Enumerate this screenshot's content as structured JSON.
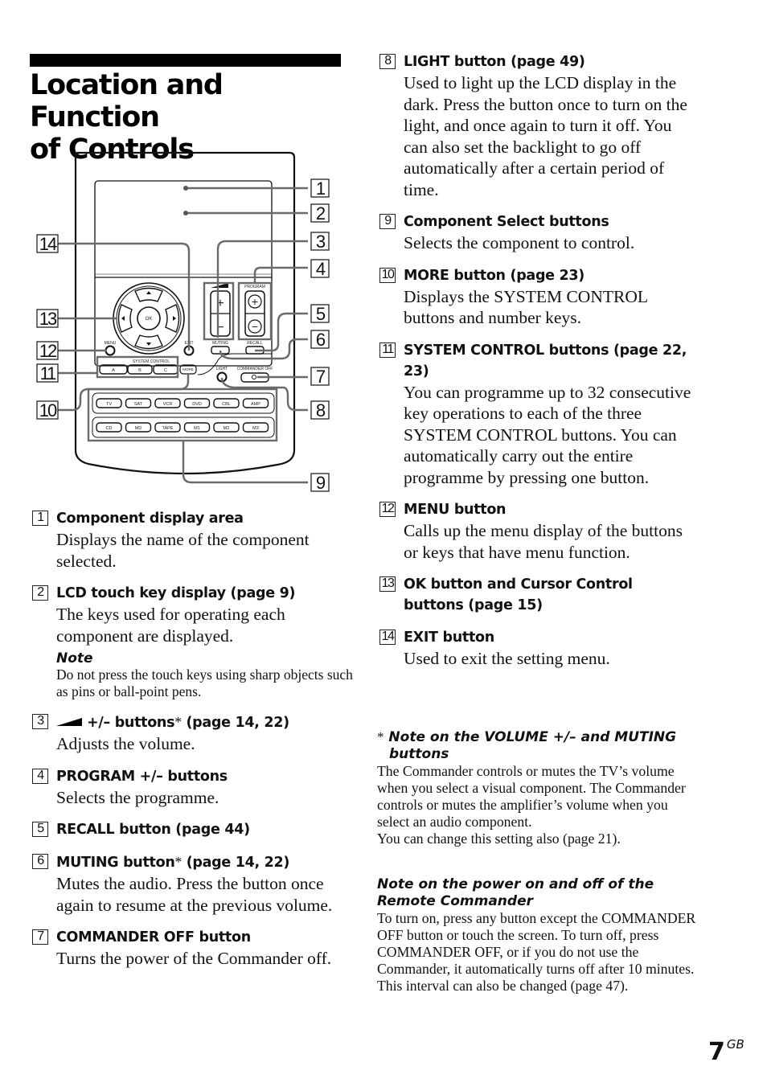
{
  "page": {
    "title": "Location and Function of Controls",
    "title_line1": "Location and Function",
    "title_line2": "of Controls",
    "page_number": "7",
    "page_suffix": "GB"
  },
  "diagram": {
    "callouts_right": [
      "1",
      "2",
      "3",
      "4",
      "5",
      "6",
      "7",
      "8",
      "9"
    ],
    "callouts_left": [
      "14",
      "13",
      "12",
      "11",
      "10"
    ],
    "labels": {
      "ok": "OK",
      "menu": "MENU",
      "exit": "EXIT",
      "muting": "MUTING",
      "recall": "RECALL",
      "program": "PROGRAM",
      "system_control": "SYSTEM CONTROL",
      "more": "MORE",
      "light": "LIGHT",
      "commander_off": "COMMANDER OFF",
      "plus": "+",
      "minus": "−"
    },
    "system_control_buttons": [
      "A",
      "B",
      "C"
    ],
    "component_row1": [
      "TV",
      "SAT",
      "VCR",
      "DVD",
      "CBL",
      "AMP"
    ],
    "component_row2": [
      "CD",
      "MD",
      "TAPE",
      "M1",
      "M2",
      "M3"
    ]
  },
  "items": [
    {
      "num": "1",
      "heading": "Component display area",
      "desc": "Displays the name of the component selected."
    },
    {
      "num": "2",
      "heading": "LCD touch key display (page 9)",
      "desc": "The keys used for operating each component are displayed.",
      "note_heading": "Note",
      "note": "Do not press the touch keys using sharp objects such as pins or ball-point pens."
    },
    {
      "num": "3",
      "heading_pre": "+/– buttons",
      "heading_ast": "*",
      "heading_post": " (page 14, 22)",
      "desc": "Adjusts the volume.",
      "icon": "volume-ramp-icon"
    },
    {
      "num": "4",
      "heading": "PROGRAM +/– buttons",
      "desc": "Selects the programme."
    },
    {
      "num": "5",
      "heading": "RECALL button (page 44)"
    },
    {
      "num": "6",
      "heading_pre": "MUTING button",
      "heading_ast": "*",
      "heading_post": " (page 14, 22)",
      "desc": "Mutes the audio. Press the button once again to resume at the previous volume."
    },
    {
      "num": "7",
      "heading": "COMMANDER OFF button",
      "desc": "Turns the power of the Commander off."
    },
    {
      "num": "8",
      "heading": "LIGHT button (page 49)",
      "desc": "Used to light up the LCD display in the dark. Press the button once to turn on the light, and once again to turn it off. You can also set the backlight to go off automatically after a certain period of time."
    },
    {
      "num": "9",
      "heading": "Component Select buttons",
      "desc": "Selects the component to control."
    },
    {
      "num": "10",
      "heading": "MORE button (page 23)",
      "desc": "Displays the SYSTEM CONTROL buttons and number keys."
    },
    {
      "num": "11",
      "heading": "SYSTEM CONTROL buttons (page 22, 23)",
      "desc": "You can programme up to 32 consecutive key operations to each of the three SYSTEM CONTROL buttons. You can automatically carry out the entire programme by pressing one button."
    },
    {
      "num": "12",
      "heading": "MENU button",
      "desc": "Calls up the menu display of the buttons or keys that have menu function."
    },
    {
      "num": "13",
      "heading": "OK button and Cursor Control buttons (page 15)"
    },
    {
      "num": "14",
      "heading": "EXIT button",
      "desc": "Used to exit the setting menu."
    }
  ],
  "footnotes": [
    {
      "marker": "*",
      "heading": "Note on the VOLUME +/– and MUTING buttons",
      "body": "The Commander controls or mutes the TV’s volume when you select a visual component. The Commander controls or mutes the amplifier’s volume when you select an audio component.",
      "body2": "You can change this setting also (page 21)."
    },
    {
      "heading": "Note on the power on and off of the Remote Commander",
      "body": "To turn on, press any button except the COMMANDER OFF button or touch the screen. To turn off, press COMMANDER OFF, or if you do not use the Commander, it automatically turns off after 10 minutes. This interval can also be changed (page 47)."
    }
  ],
  "colors": {
    "text": "#111111",
    "leader": "#6a6a6a",
    "device_outline": "#111111"
  }
}
